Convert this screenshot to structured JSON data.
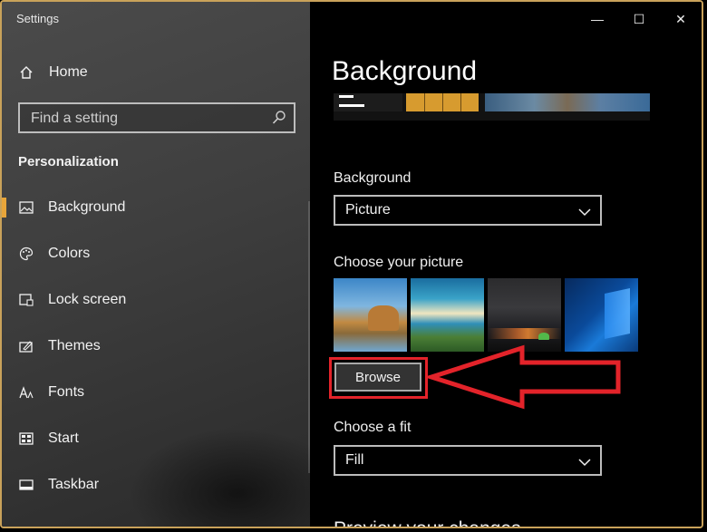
{
  "window": {
    "title": "Settings",
    "minimize": "—",
    "maximize": "☐",
    "close": "✕"
  },
  "sidebar": {
    "home_label": "Home",
    "search_placeholder": "Find a setting",
    "section": "Personalization",
    "items": [
      {
        "label": "Background",
        "icon": "picture-icon",
        "active": true
      },
      {
        "label": "Colors",
        "icon": "palette-icon"
      },
      {
        "label": "Lock screen",
        "icon": "lock-screen-icon"
      },
      {
        "label": "Themes",
        "icon": "themes-icon"
      },
      {
        "label": "Fonts",
        "icon": "fonts-icon"
      },
      {
        "label": "Start",
        "icon": "start-icon"
      },
      {
        "label": "Taskbar",
        "icon": "taskbar-icon"
      }
    ]
  },
  "main": {
    "title": "Background",
    "background_label": "Background",
    "background_value": "Picture",
    "choose_picture_label": "Choose your picture",
    "browse_label": "Browse",
    "choose_fit_label": "Choose a fit",
    "fit_value": "Fill",
    "preview_heading": "Preview your changes"
  },
  "colors": {
    "accent": "#e8a53a",
    "annotation": "#e3232a"
  }
}
